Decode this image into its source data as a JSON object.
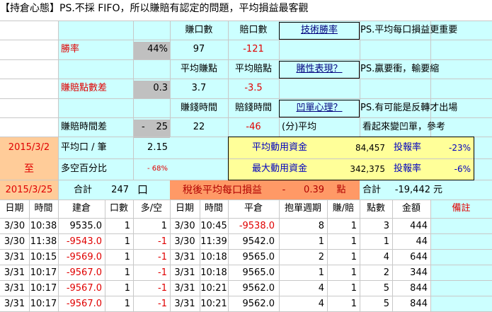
{
  "title": "【持倉心態】PS.不採 FIFO，所以賺賠有認定的問題，平均損益最客觀",
  "stats": {
    "h_win_count": "賺口數",
    "h_loss_count": "賠口數",
    "link_tech": "技術勝率",
    "note1": "PS.平均每口損益更重要",
    "win_rate_label": "勝率",
    "win_rate": "44%",
    "win_count": "97",
    "loss_count": "-121",
    "h_avg_win_pts": "平均賺點",
    "h_avg_loss_pts": "平均賠點",
    "link_gamble": "賭性表現？",
    "note2": "PS.贏要衝，輸要縮",
    "ratio_label": "賺賠點數差",
    "ratio": "0.3",
    "avg_win_pts": "3.7",
    "avg_loss_pts": "-3.5",
    "h_win_time": "賺錢時間",
    "h_loss_time": "賠錢時間",
    "link_flip": "凹單心理？",
    "note3": "PS.有可能是反轉才出場",
    "time_diff_label": "賺賠時間差",
    "time_diff_sign": "-",
    "time_diff": "25",
    "win_time": "22",
    "loss_time": "-46",
    "time_unit": "(分)平均",
    "note4": "看起來變凹單，參考"
  },
  "period": {
    "start": "2015/3/2",
    "to": "至",
    "end": "2015/3/25"
  },
  "summary": {
    "avg_lots_label": "平均口 / 筆",
    "avg_lots": "2.15",
    "long_short_label": "多空百分比",
    "long_short": "- 68%",
    "total_label": "合計",
    "total_lots": "247",
    "lots_unit": "口",
    "avg_capital_label": "平均動用資金",
    "avg_capital": "84,457",
    "max_capital_label": "最大動用資金",
    "max_capital": "342,375",
    "roi_label1": "投報率",
    "roi1": "-23%",
    "roi_label2": "投報率",
    "roi2": "-6%",
    "net_label": "稅後平均每口損益",
    "net_sign": "-",
    "net_value": "0.39",
    "net_unit": "點",
    "sum_label": "合計",
    "sum_value": "-19,442",
    "sum_unit": "元"
  },
  "table": {
    "headers": [
      "日期",
      "時間",
      "建倉",
      "口數",
      "多/空",
      "日期",
      "時間",
      "平倉",
      "抱單週期",
      "賺/賠",
      "點數",
      "金額",
      "備註"
    ],
    "rows": [
      [
        "3/30",
        "10:38",
        "9535.0",
        "1",
        "1",
        "3/30",
        "10:45",
        "-9538.0",
        "8",
        "1",
        "3",
        "444"
      ],
      [
        "3/30",
        "11:38",
        "-9543.0",
        "1",
        "-1",
        "3/30",
        "11:39",
        "9542.0",
        "1",
        "1",
        "1",
        "44"
      ],
      [
        "3/31",
        "10:15",
        "-9569.0",
        "1",
        "-1",
        "3/31",
        "10:18",
        "9565.0",
        "2",
        "1",
        "4",
        "644"
      ],
      [
        "3/31",
        "10:17",
        "-9567.0",
        "1",
        "-1",
        "3/31",
        "10:18",
        "9565.0",
        "1",
        "1",
        "2",
        "344"
      ],
      [
        "3/31",
        "10:17",
        "-9567.0",
        "1",
        "-1",
        "3/31",
        "10:21",
        "9562.0",
        "4",
        "1",
        "5",
        "844"
      ],
      [
        "3/31",
        "10:17",
        "-9567.0",
        "1",
        "-1",
        "3/31",
        "10:21",
        "9562.0",
        "4",
        "1",
        "5",
        "844"
      ]
    ]
  },
  "colors": {
    "cyan": "#ccffff",
    "peach": "#ffcc99",
    "yellow": "#ffff99",
    "gray": "#c0c0c0",
    "salmon": "#ff9966",
    "red": "#e00000"
  }
}
